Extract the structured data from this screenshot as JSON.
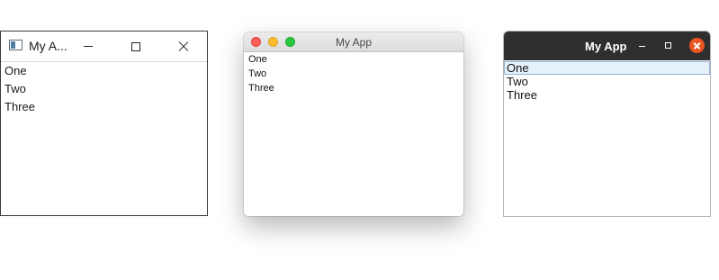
{
  "windows_window": {
    "title": "My A...",
    "items": [
      "One",
      "Two",
      "Three"
    ]
  },
  "mac_window": {
    "title": "My App",
    "items": [
      "One",
      "Two",
      "Three"
    ]
  },
  "gtk_window": {
    "title": "My App",
    "items": [
      "One",
      "Two",
      "Three"
    ],
    "selected_item": "One"
  },
  "icons": {
    "windows": [
      "app-icon",
      "minimize-icon",
      "maximize-icon",
      "close-icon"
    ],
    "mac": [
      "close-traffic-light",
      "minimize-traffic-light",
      "zoom-traffic-light"
    ],
    "gtk": [
      "minimize-icon",
      "maximize-icon",
      "close-icon"
    ]
  },
  "colors": {
    "mac_close": "#fe5f57",
    "mac_minimize": "#febc2e",
    "mac_zoom": "#28c840",
    "gtk_titlebar": "#2f2f2f",
    "gtk_close": "#e95420",
    "gtk_selection": "#e6f0fa"
  }
}
